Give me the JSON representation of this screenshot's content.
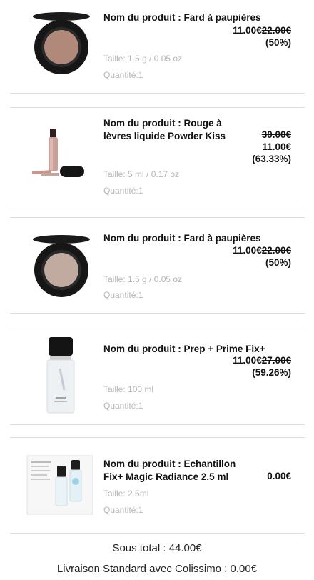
{
  "items": [
    {
      "name_prefix": "Nom du produit : ",
      "name": "Fard à paupières",
      "price_new": "11.00€",
      "price_old": "22.00€",
      "discount": "(50%)",
      "size_label": "Taille: ",
      "size": "1.5 g / 0.05 oz",
      "qty_label": "Quantité:",
      "qty": "1",
      "image_icon": "eyeshadow-compact-icon"
    },
    {
      "name_prefix": "Nom du produit : ",
      "name": "Rouge à lèvres liquide Powder Kiss",
      "price_old": "30.00€",
      "price_new": "11.00€",
      "discount": "(63.33%)",
      "size_label": "Taille: ",
      "size": "5 ml / 0.17 oz",
      "qty_label": "Quantité:",
      "qty": "1",
      "image_icon": "liquid-lipstick-icon"
    },
    {
      "name_prefix": "Nom du produit : ",
      "name": "Fard à paupières",
      "price_new": "11.00€",
      "price_old": "22.00€",
      "discount": "(50%)",
      "size_label": "Taille: ",
      "size": "1.5 g / 0.05 oz",
      "qty_label": "Quantité:",
      "qty": "1",
      "image_icon": "eyeshadow-compact-icon"
    },
    {
      "name_prefix": "Nom du produit : ",
      "name": "Prep + Prime Fix+",
      "price_new": "11.00€",
      "price_old": "27.00€",
      "discount": "(59.26%)",
      "size_label": "Taille: ",
      "size": "100 ml",
      "qty_label": "Quantité:",
      "qty": "1",
      "image_icon": "spray-bottle-icon"
    },
    {
      "name_prefix": "Nom du produit : ",
      "name": "Echantillon Fix+ Magic Radiance 2.5 ml",
      "price_new": "0.00€",
      "size_label": "Taille: ",
      "size": "2.5ml",
      "qty_label": "Quantité:",
      "qty": "1",
      "image_icon": "sample-card-icon"
    }
  ],
  "totals": {
    "subtotal": "Sous total : 44.00€",
    "shipping": "Livraison Standard avec Colissimo : 0.00€"
  },
  "colors": {
    "divider": "#dcdcdc",
    "muted_text": "#b5b5b5",
    "compact_case": "#1a1a1a",
    "eyeshadow_fill": "#b0897a"
  }
}
